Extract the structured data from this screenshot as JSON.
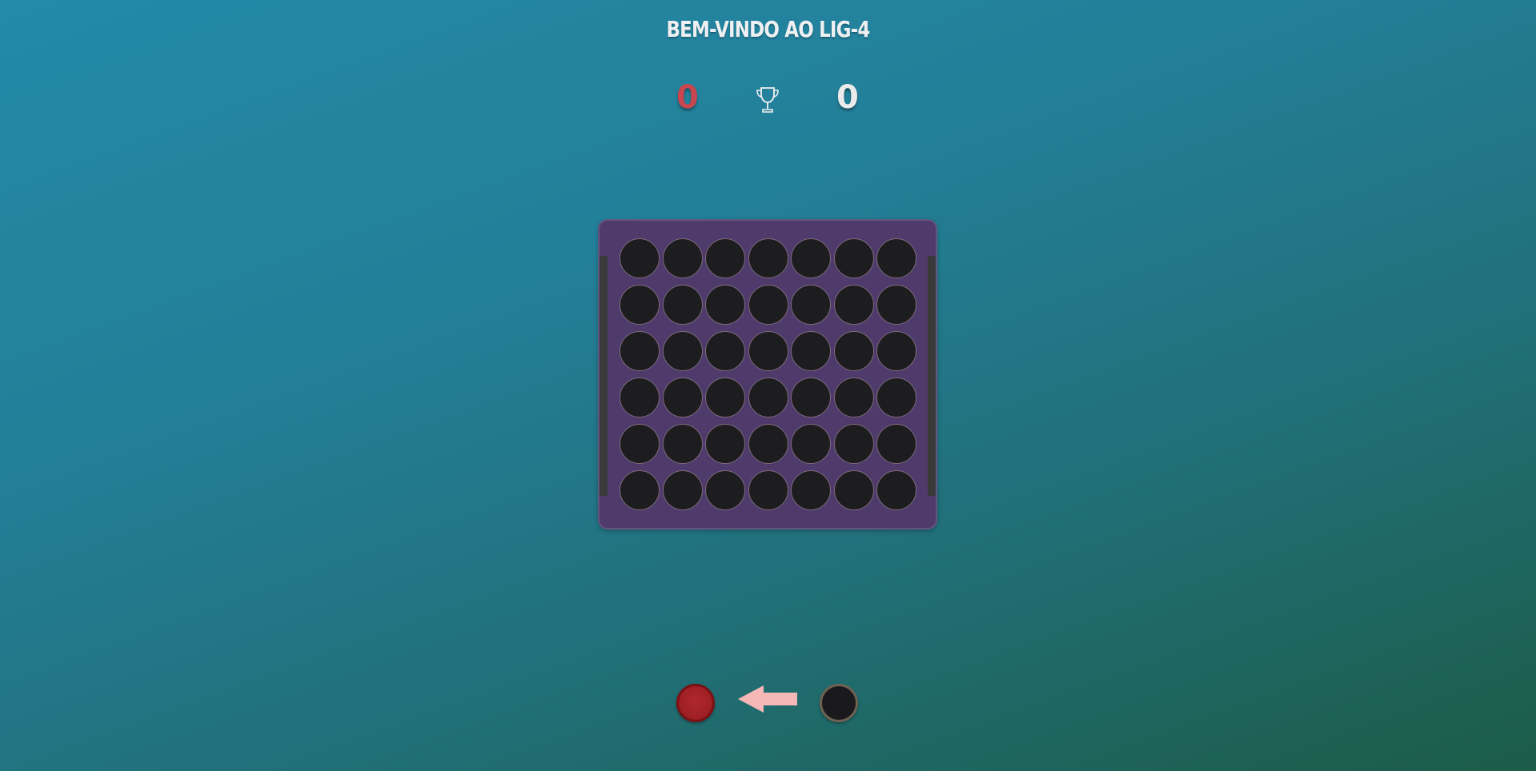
{
  "header": {
    "title": "BEM-VINDO AO LIG-4"
  },
  "scoreboard": {
    "red_score": "0",
    "black_score": "0",
    "trophy_icon": "trophy-icon"
  },
  "board": {
    "columns": 7,
    "rows": 6,
    "cells": [
      [
        "empty",
        "empty",
        "empty",
        "empty",
        "empty",
        "empty",
        "empty"
      ],
      [
        "empty",
        "empty",
        "empty",
        "empty",
        "empty",
        "empty",
        "empty"
      ],
      [
        "empty",
        "empty",
        "empty",
        "empty",
        "empty",
        "empty",
        "empty"
      ],
      [
        "empty",
        "empty",
        "empty",
        "empty",
        "empty",
        "empty",
        "empty"
      ],
      [
        "empty",
        "empty",
        "empty",
        "empty",
        "empty",
        "empty",
        "empty"
      ],
      [
        "empty",
        "empty",
        "empty",
        "empty",
        "empty",
        "empty",
        "empty"
      ]
    ]
  },
  "turn": {
    "current_player": "red",
    "arrow_icon": "arrow-left-icon"
  },
  "colors": {
    "red_player": "#9d1f24",
    "black_player": "#1a1a1c",
    "board": "#4e3b6b",
    "arrow": "#f6b7b7",
    "red_score": "#c9464f"
  }
}
